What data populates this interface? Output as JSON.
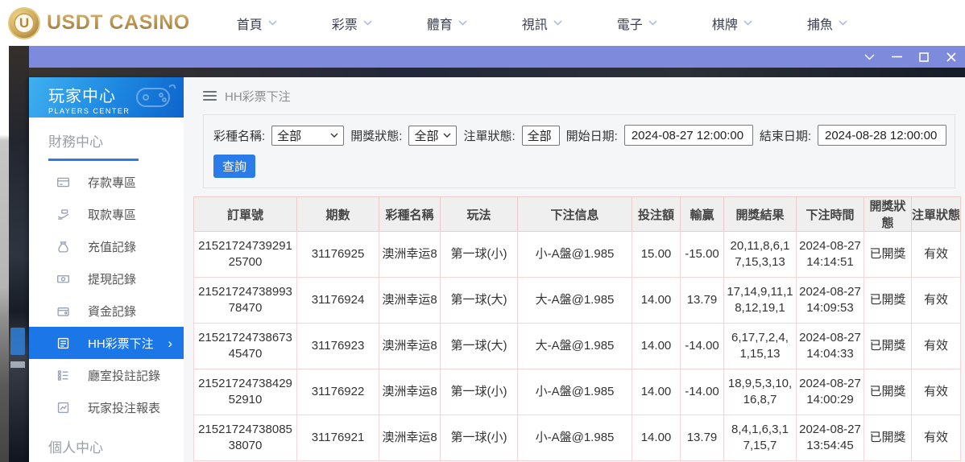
{
  "colors": {
    "accent_blue": "#1b76e8",
    "button_blue": "#2b7ce9",
    "titlebar_purple": "#7e8bdc",
    "logo_gold": "#b08d3e",
    "sidebar_header_gradient": [
      "#3fb0f0",
      "#0d64cc"
    ],
    "table_border_pink": "#f0cbcb",
    "table_header_bg": "#efefef"
  },
  "icons": {
    "chevron_right": "›",
    "window_controls": [
      "chevron-down-icon",
      "minimize-icon",
      "maximize-icon",
      "close-icon"
    ]
  },
  "topnav": {
    "logo_text": "USDT CASINO",
    "logo_coin_letter": "U",
    "items": [
      {
        "label": "首頁"
      },
      {
        "label": "彩票"
      },
      {
        "label": "體育"
      },
      {
        "label": "視訊"
      },
      {
        "label": "電子"
      },
      {
        "label": "棋牌"
      },
      {
        "label": "捕魚"
      }
    ]
  },
  "sidebar": {
    "header": {
      "title": "玩家中心",
      "subtitle": "PLAYERS CENTER"
    },
    "section_finance": "財務中心",
    "section_personal": "個人中心",
    "items": [
      {
        "label": "存款專區",
        "icon": "deposit-card-icon",
        "active": false
      },
      {
        "label": "取款專區",
        "icon": "withdraw-hand-icon",
        "active": false
      },
      {
        "label": "充值記錄",
        "icon": "recharge-moneybag-icon",
        "active": false
      },
      {
        "label": "提現記錄",
        "icon": "withdrawal-cash-icon",
        "active": false
      },
      {
        "label": "資金記錄",
        "icon": "funds-wallet-icon",
        "active": false
      },
      {
        "label": "HH彩票下注",
        "icon": "lottery-bet-doc-icon",
        "active": true
      },
      {
        "label": "廳室投註記錄",
        "icon": "room-bet-list-icon",
        "active": false
      },
      {
        "label": "玩家投注報表",
        "icon": "player-report-chart-icon",
        "active": false
      }
    ]
  },
  "main": {
    "breadcrumb": "HH彩票下注",
    "filters": {
      "lottery_label": "彩種名稱:",
      "lottery_value": "全部",
      "draw_status_label": "開獎狀態:",
      "draw_status_value": "全部",
      "order_status_label": "注單狀態:",
      "order_status_value": "全部",
      "start_label": "開始日期:",
      "start_value": "2024-08-27 12:00:00",
      "end_label": "結束日期:",
      "end_value": "2024-08-28 12:00:00",
      "search_button": "查詢"
    },
    "table": {
      "headers": [
        "訂單號",
        "期數",
        "彩種名稱",
        "玩法",
        "下注信息",
        "投注額",
        "輸贏",
        "開獎結果",
        "下注時間",
        "開獎狀態",
        "注單狀態"
      ],
      "rows": [
        {
          "order_id": "2152172473929125700",
          "period": "31176925",
          "lottery": "澳洲幸运8",
          "play": "第一球(小)",
          "bet_info": "小-A盤@1.985",
          "amount": "15.00",
          "win_loss": "-15.00",
          "result": "20,11,8,6,17,15,3,13",
          "bet_time": "2024-08-27 14:14:51",
          "draw_status": "已開獎",
          "order_status": "有效"
        },
        {
          "order_id": "2152172473899378470",
          "period": "31176924",
          "lottery": "澳洲幸运8",
          "play": "第一球(大)",
          "bet_info": "大-A盤@1.985",
          "amount": "14.00",
          "win_loss": "13.79",
          "result": "17,14,9,11,18,12,19,1",
          "bet_time": "2024-08-27 14:09:53",
          "draw_status": "已開獎",
          "order_status": "有效"
        },
        {
          "order_id": "2152172473867345470",
          "period": "31176923",
          "lottery": "澳洲幸运8",
          "play": "第一球(大)",
          "bet_info": "大-A盤@1.985",
          "amount": "14.00",
          "win_loss": "-14.00",
          "result": "6,17,7,2,4,1,15,13",
          "bet_time": "2024-08-27 14:04:33",
          "draw_status": "已開獎",
          "order_status": "有效"
        },
        {
          "order_id": "2152172473842952910",
          "period": "31176922",
          "lottery": "澳洲幸运8",
          "play": "第一球(小)",
          "bet_info": "小-A盤@1.985",
          "amount": "14.00",
          "win_loss": "-14.00",
          "result": "18,9,5,3,10,16,8,7",
          "bet_time": "2024-08-27 14:00:29",
          "draw_status": "已開獎",
          "order_status": "有效"
        },
        {
          "order_id": "2152172473808538070",
          "period": "31176921",
          "lottery": "澳洲幸运8",
          "play": "第一球(小)",
          "bet_info": "小-A盤@1.985",
          "amount": "14.00",
          "win_loss": "13.79",
          "result": "8,4,1,6,3,17,15,7",
          "bet_time": "2024-08-27 13:54:45",
          "draw_status": "已開獎",
          "order_status": "有效"
        }
      ]
    }
  }
}
